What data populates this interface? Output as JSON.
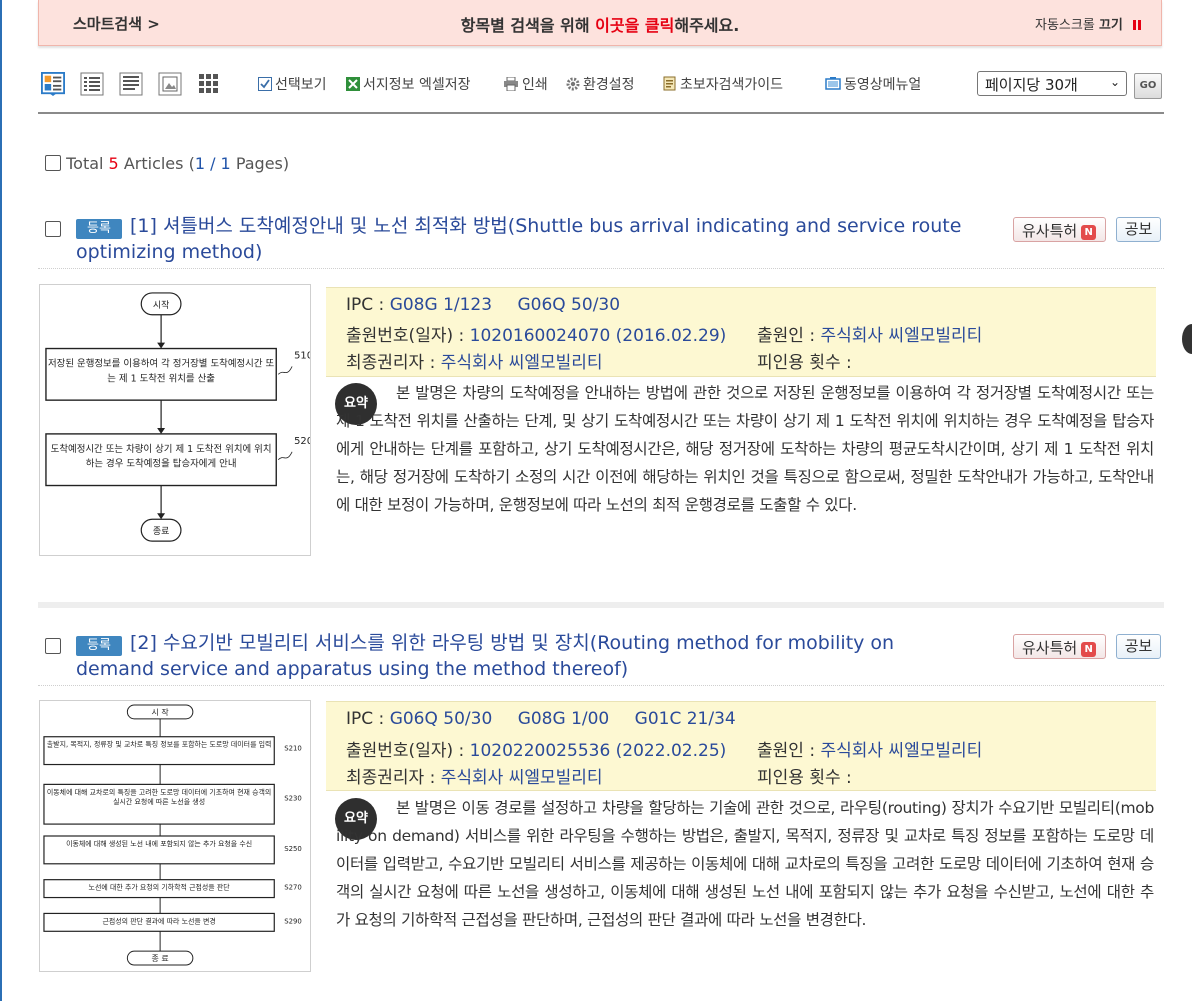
{
  "banner": {
    "smart_search": "스마트검색 >",
    "message_prefix": "항목별 검색을 위해 ",
    "message_link": "이곳을 클릭",
    "message_suffix": "해주세요.",
    "auto_scroll_label": "자동스크롤 ",
    "auto_scroll_state": "끄기"
  },
  "toolbar": {
    "items": [
      "선택보기",
      "서지정보 엑셀저장",
      "인쇄",
      "환경설정",
      "초보자검색가이드",
      "동영상메뉴얼"
    ],
    "per_page": "페이지당 30개",
    "go": "GO"
  },
  "total": {
    "prefix": "Total ",
    "count": "5",
    "articles": " Articles (",
    "page": "1 / 1",
    "pages": " Pages)"
  },
  "labels": {
    "ipc": "IPC :",
    "application_no": "출원번호(일자) :",
    "applicant": "출원인 :",
    "final_holder": "최종권리자 :",
    "citations": "피인용 횟수 :",
    "similar": "유사특허",
    "similar_badge": "N",
    "publication": "공보",
    "abstract_icon": "요약"
  },
  "articles": [
    {
      "status": "등록",
      "title": "[1] 셔틀버스 도착예정안내 및 노선 최적화 방법(Shuttle bus arrival indicating and service route optimizing method)",
      "ipc": [
        "G08G 1/123",
        "G06Q 50/30"
      ],
      "application_no": "1020160024070 (2016.02.29)",
      "applicant": "주식회사 씨엘모빌리티",
      "final_holder": "주식회사 씨엘모빌리티",
      "citations": "",
      "abstract": "본 발명은 차량의 도착예정을 안내하는 방법에 관한 것으로 저장된 운행정보를 이용하여 각 정거장별 도착예정시간 또는 제 1 도착전 위치를 산출하는 단계, 및 상기 도착예정시간 또는 차량이 상기 제 1 도착전 위치에 위치하는 경우 도착예정을 탑승자에게 안내하는 단계를 포함하고, 상기 도착예정시간은, 해당 정거장에 도착하는 차량의 평균도착시간이며, 상기 제 1 도착전 위치는, 해당 정거장에 도착하기 소정의 시간 이전에 해당하는 위치인 것을 특징으로 함으로써, 정밀한 도착안내가 가능하고, 도착안내에 대한 보정이 가능하며, 운행정보에 따라 노선의 최적 운행경로를 도출할 수 있다.",
      "figure": {
        "start": "시작",
        "end": "종료",
        "steps": [
          {
            "text": "저장된 운행정보를 이용하여 각 정거장별 도착예정시간 또는 제 1 도착전 위치를 산출",
            "ref": "510"
          },
          {
            "text": "도착예정시간 또는 차량이 상기 제 1 도착전 위치에 위치하는 경우 도착예정을 탑승자에게 안내",
            "ref": "520"
          }
        ]
      }
    },
    {
      "status": "등록",
      "title": "[2] 수요기반 모빌리티 서비스를 위한 라우팅 방법 및 장치(Routing method for mobility on demand service and apparatus using the method thereof)",
      "ipc": [
        "G06Q 50/30",
        "G08G 1/00",
        "G01C 21/34"
      ],
      "application_no": "1020220025536 (2022.02.25)",
      "applicant": "주식회사 씨엘모빌리티",
      "final_holder": "주식회사 씨엘모빌리티",
      "citations": "",
      "abstract": "본 발명은 이동 경로를 설정하고 차량을 할당하는 기술에 관한 것으로, 라우팅(routing) 장치가 수요기반 모빌리티(mobility on demand) 서비스를 위한 라우팅을 수행하는 방법은, 출발지, 목적지, 정류장 및 교차로 특징 정보를 포함하는 도로망 데이터를 입력받고, 수요기반 모빌리티 서비스를 제공하는 이동체에 대해 교차로의 특징을 고려한 도로망 데이터에 기초하여 현재 승객의 실시간 요청에 따른 노선을 생성하고, 이동체에 대해 생성된 노선 내에 포함되지 않는 추가 요청을 수신받고, 노선에 대한 추가 요청의 기하학적 근접성을 판단하며, 근접성의 판단 결과에 따라 노선을 변경한다.",
      "figure": {
        "start": "시 작",
        "end": "종 료",
        "steps": [
          {
            "text": "출발지, 목적지, 정류장 및 교차로 특징 정보를 포함하는 도로망 데이터를 입력",
            "ref": "S210"
          },
          {
            "text": "이동체에 대해 교차로의 특징을 고려한 도로망 데이터에 기초하여 현재 승객의 실시간 요청에 따른 노선을 생성",
            "ref": "S230"
          },
          {
            "text": "이동체에 대해 생성된 노선 내에 포함되지 않는 추가 요청을 수신",
            "ref": "S250"
          },
          {
            "text": "노선에 대한 추가 요청의 기하학적 근접성을 판단",
            "ref": "S270"
          },
          {
            "text": "근접성의 판단 결과에 따라 노선을 변경",
            "ref": "S290"
          }
        ]
      }
    }
  ]
}
